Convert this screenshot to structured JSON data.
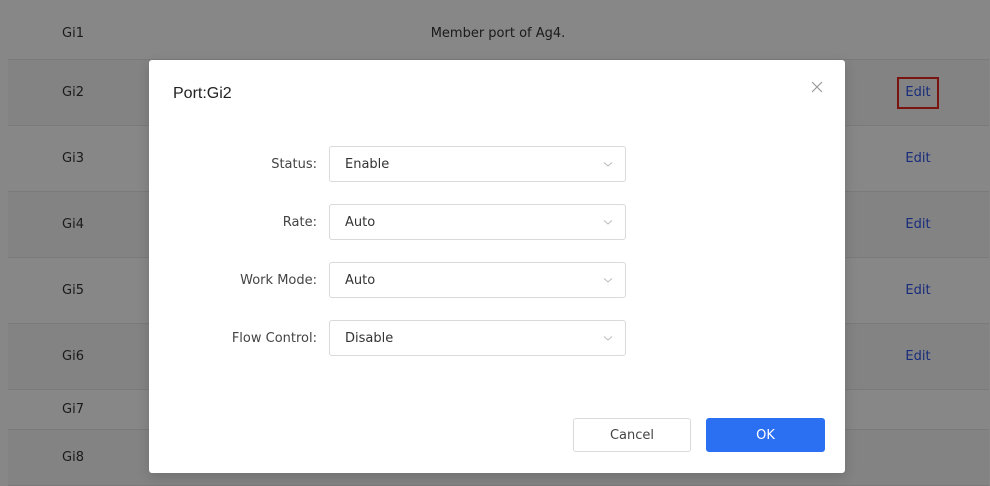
{
  "table": {
    "rows": [
      {
        "port": "Gi1",
        "note": "Member port of Ag4.",
        "action": ""
      },
      {
        "port": "Gi2",
        "note": "",
        "action": "Edit"
      },
      {
        "port": "Gi3",
        "note": "",
        "action": "Edit"
      },
      {
        "port": "Gi4",
        "note": "",
        "action": "Edit"
      },
      {
        "port": "Gi5",
        "note": "",
        "action": "Edit"
      },
      {
        "port": "Gi6",
        "note": "",
        "action": "Edit"
      },
      {
        "port": "Gi7",
        "note": "",
        "action": ""
      },
      {
        "port": "Gi8",
        "note": "",
        "action": ""
      }
    ]
  },
  "modal": {
    "title": "Port:Gi2",
    "close_icon": "close-icon",
    "fields": [
      {
        "label": "Status:",
        "value": "Enable"
      },
      {
        "label": "Rate:",
        "value": "Auto"
      },
      {
        "label": "Work Mode:",
        "value": "Auto"
      },
      {
        "label": "Flow Control:",
        "value": "Disable"
      }
    ],
    "cancel_label": "Cancel",
    "ok_label": "OK"
  },
  "colors": {
    "link": "#2f54eb",
    "primary": "#2b6ff3",
    "highlight_border": "#e8261c"
  }
}
